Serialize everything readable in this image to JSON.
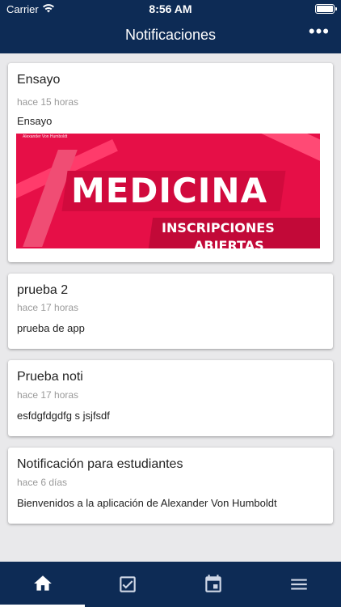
{
  "status_bar": {
    "carrier": "Carrier",
    "time": "8:56 AM"
  },
  "header": {
    "title": "Notificaciones",
    "more_icon": "more-horizontal-icon"
  },
  "notifications": [
    {
      "title": "Ensayo",
      "time": "hace 15 horas",
      "body": "Ensayo",
      "image": {
        "logo_text": "Alexander Von Humboldt",
        "headline": "MEDICINA",
        "subline1": "INSCRIPCIONES",
        "subline2": "ABIERTAS"
      }
    },
    {
      "title": "prueba 2",
      "time": "hace 17 horas",
      "body": "prueba de app"
    },
    {
      "title": "Prueba noti",
      "time": "hace 17 horas",
      "body": "esfdgfdgdfg s jsjfsdf"
    },
    {
      "title": "Notificación para estudiantes",
      "time": "hace 6 días",
      "body": "Bienvenidos a la aplicación de Alexander Von Humboldt"
    }
  ],
  "tabs": [
    {
      "icon": "home-icon",
      "active": true
    },
    {
      "icon": "checkbox-icon",
      "active": false
    },
    {
      "icon": "calendar-icon",
      "active": false
    },
    {
      "icon": "menu-icon",
      "active": false
    }
  ],
  "colors": {
    "primary": "#0d2b55",
    "background": "#e9e9eb",
    "banner": "#e60f47"
  }
}
